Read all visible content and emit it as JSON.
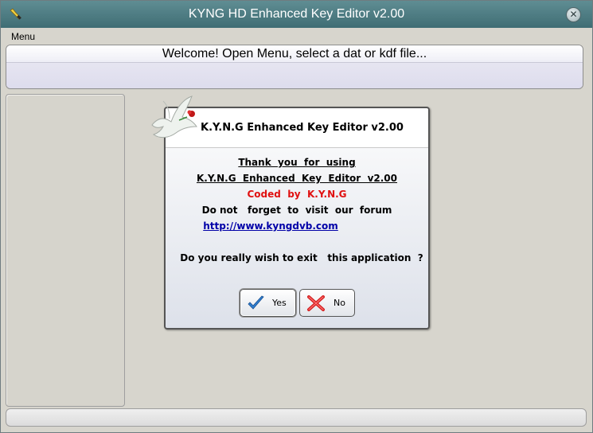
{
  "window": {
    "title": "KYNG HD Enhanced Key Editor v2.00",
    "close_glyph": "✕"
  },
  "menu": {
    "items": [
      {
        "label": "Menu"
      }
    ]
  },
  "status": {
    "message": "Welcome!   Open Menu, select a dat or kdf file..."
  },
  "dialog": {
    "title": "K.Y.N.G Enhanced Key Editor v2.00",
    "lines": {
      "thanks": "Thank  you  for  using",
      "product": "K.Y.N.G  Enhanced  Key  Editor  v2.00",
      "coded": "Coded  by  K.Y.N.G",
      "forum": "Do not   forget  to  visit  our  forum",
      "url": "http://www.kyngdvb.com",
      "question": "Do you really wish to exit   this application  ?"
    },
    "buttons": {
      "yes": "Yes",
      "no": "No"
    }
  },
  "colors": {
    "titlebar": "#4f7d84",
    "accent_red": "#e01010",
    "link_blue": "#0000a8"
  },
  "icons": {
    "app": "wrench-icon",
    "decoration": "dove-icon",
    "yes": "checkmark-icon",
    "no": "x-mark-icon"
  }
}
